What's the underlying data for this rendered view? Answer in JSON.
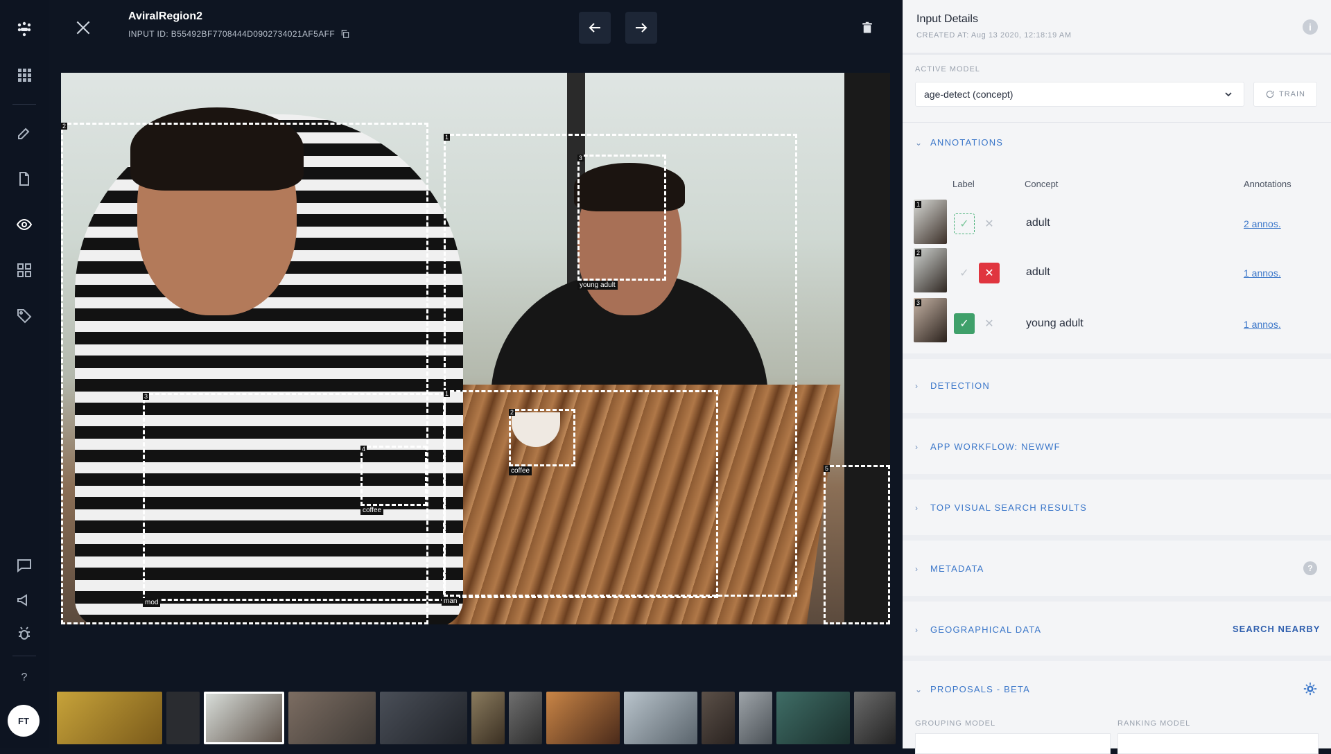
{
  "rail": {
    "icons": [
      "logo-icon",
      "grid-icon",
      "edit-icon",
      "document-icon",
      "eye-icon",
      "apps-icon",
      "tag-icon",
      "chat-icon",
      "megaphone-icon",
      "bug-icon",
      "help-icon"
    ],
    "help_label": "?",
    "avatar_initials": "FT"
  },
  "viewer": {
    "title": "AviralRegion2",
    "input_id": "INPUT ID: B55492BF7708444D0902734021AF5AFF",
    "boxes": [
      {
        "num": "2",
        "label": ""
      },
      {
        "num": "1",
        "label": ""
      },
      {
        "num": "3",
        "label": "young adult"
      },
      {
        "num": "3",
        "label": "mod"
      },
      {
        "num": "4",
        "label": "coffee"
      },
      {
        "num": "2",
        "label": "coffee"
      },
      {
        "num": "1",
        "label": "man"
      },
      {
        "num": "5",
        "label": ""
      }
    ]
  },
  "panel": {
    "title": "Input Details",
    "created": "CREATED AT: Aug 13 2020, 12:18:19 AM",
    "active_model_label": "ACTIVE MODEL",
    "active_model_value": "age-detect (concept)",
    "train_label": "TRAIN",
    "annotations_header": "ANNOTATIONS",
    "columns": {
      "label": "Label",
      "concept": "Concept",
      "annotations": "Annotations"
    },
    "rows": [
      {
        "num": "1",
        "concept": "adult",
        "annos": "2 annos."
      },
      {
        "num": "2",
        "concept": "adult",
        "annos": "1 annos."
      },
      {
        "num": "3",
        "concept": "young adult",
        "annos": "1 annos."
      }
    ],
    "sections": {
      "detection": "DETECTION",
      "workflow": "APP WORKFLOW: NEWWF",
      "visual_search": "TOP VISUAL SEARCH RESULTS",
      "metadata": "METADATA",
      "geo": "GEOGRAPHICAL DATA",
      "proposals": "PROPOSALS - BETA"
    },
    "search_nearby": "SEARCH NEARBY",
    "grouping_model_label": "GROUPING MODEL",
    "ranking_model_label": "RANKING MODEL",
    "colors": {
      "accent": "#3a76c9",
      "approve": "#3fa06a",
      "reject": "#e0353f"
    }
  }
}
